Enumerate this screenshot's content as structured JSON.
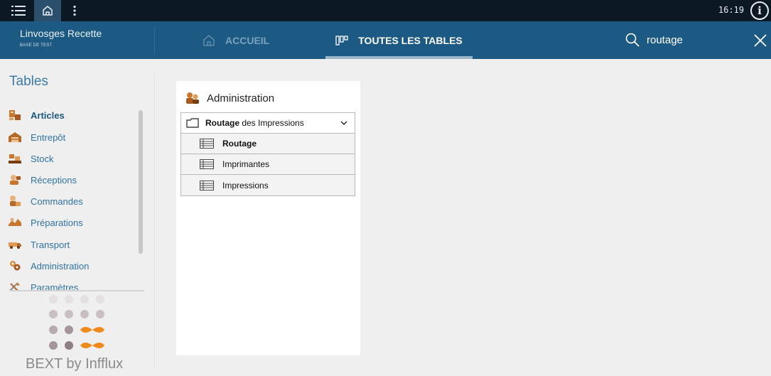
{
  "topbar": {
    "time": "16:19",
    "info_symbol": "i",
    "icons": [
      "list-menu-icon",
      "home-icon",
      "more-vertical-icon",
      "info-icon"
    ]
  },
  "header": {
    "app_title": "Linvosges Recette",
    "app_subtitle": "BASE DE TEST",
    "nav": {
      "home_label": "ACCUEIL",
      "tables_label": "TOUTES LES TABLES"
    },
    "search": {
      "value": "routage"
    }
  },
  "sidebar": {
    "title": "Tables",
    "items": [
      {
        "label": "Articles",
        "active": true,
        "icon": "articles-icon"
      },
      {
        "label": "Entrepôt",
        "active": false,
        "icon": "warehouse-icon"
      },
      {
        "label": "Stock",
        "active": false,
        "icon": "stock-icon"
      },
      {
        "label": "Réceptions",
        "active": false,
        "icon": "receptions-icon"
      },
      {
        "label": "Commandes",
        "active": false,
        "icon": "orders-icon"
      },
      {
        "label": "Préparations",
        "active": false,
        "icon": "preparations-icon"
      },
      {
        "label": "Transport",
        "active": false,
        "icon": "transport-icon"
      },
      {
        "label": "Administration",
        "active": false,
        "icon": "administration-icon"
      },
      {
        "label": "Paramètres",
        "active": false,
        "icon": "settings-icon"
      }
    ],
    "brand": "BEXT by Infflux"
  },
  "card": {
    "title": "Administration",
    "group": {
      "label_highlight": "Routage",
      "label_rest": " des Impressions",
      "expanded": true
    },
    "tables": [
      {
        "label": "Routage",
        "active": true
      },
      {
        "label": "Imprimantes",
        "active": false
      },
      {
        "label": "Impressions",
        "active": false
      }
    ]
  },
  "colors": {
    "topbar": "#0c1824",
    "header": "#1d5a83",
    "accent_orange": "#f08a1c",
    "link_blue": "#2f73a5"
  }
}
